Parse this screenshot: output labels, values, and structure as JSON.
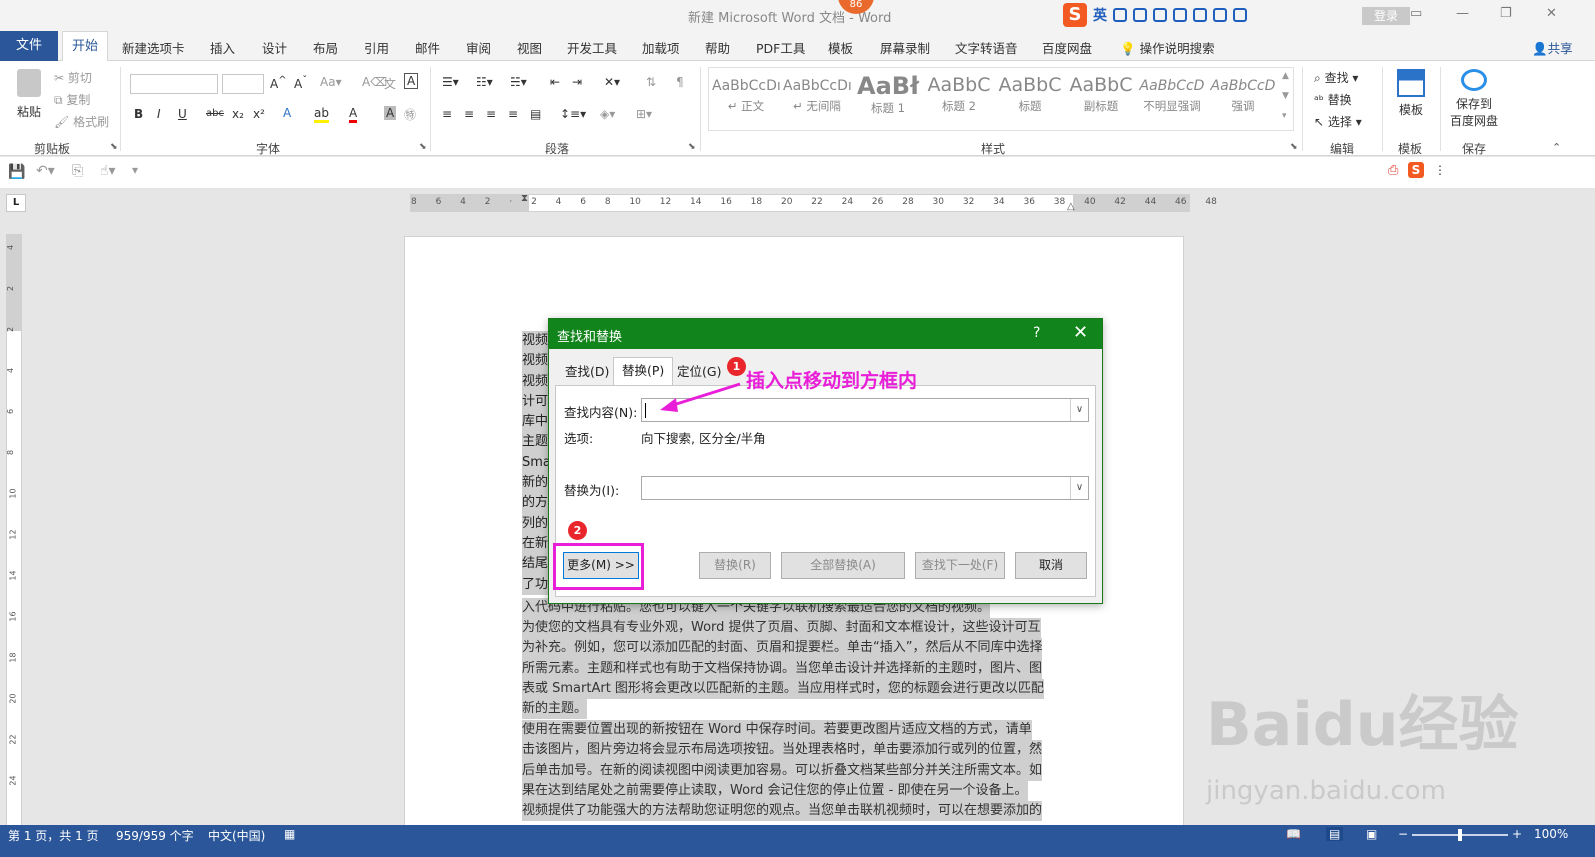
{
  "titlebar": {
    "doc_title": "新建 Microsoft Word 文档",
    "app_name": "Word",
    "notif_count": "86",
    "ime_mode": "英",
    "login": "登录"
  },
  "tabs": {
    "file": "文件",
    "active": "开始",
    "items": [
      "新建选项卡",
      "插入",
      "设计",
      "布局",
      "引用",
      "邮件",
      "审阅",
      "视图",
      "开发工具",
      "加载项",
      "帮助",
      "PDF工具",
      "模板",
      "屏幕录制",
      "文字转语音",
      "百度网盘"
    ],
    "tellme": "操作说明搜索",
    "share": "共享"
  },
  "ribbon": {
    "clipboard": {
      "label": "剪贴板",
      "paste": "粘贴",
      "cut": "剪切",
      "copy": "复制",
      "format_painter": "格式刷"
    },
    "font": {
      "label": "字体"
    },
    "paragraph": {
      "label": "段落"
    },
    "styles": {
      "label": "样式",
      "items": [
        {
          "preview": "AaBbCcDı",
          "name": "↵ 正文"
        },
        {
          "preview": "AaBbCcDı",
          "name": "↵ 无间隔"
        },
        {
          "preview": "AaBł",
          "name": "标题 1"
        },
        {
          "preview": "AaBbC",
          "name": "标题 2"
        },
        {
          "preview": "AaBbC",
          "name": "标题"
        },
        {
          "preview": "AaBbC",
          "name": "副标题"
        },
        {
          "preview": "AaBbCcD",
          "name": "不明显强调"
        },
        {
          "preview": "AaBbCcD",
          "name": "强调"
        }
      ]
    },
    "editing": {
      "label": "编辑",
      "find": "查找",
      "replace": "替换",
      "select": "选择"
    },
    "template": {
      "label": "模板",
      "button": "模板"
    },
    "save": {
      "label": "保存",
      "button_line1": "保存到",
      "button_line2": "百度网盘"
    }
  },
  "ruler": {
    "h_ticks": "8 6 4 2 · 2 4 6 8 10 12 14 16 18 20 22 24 26 28 30 32 34 36 38 40 42 44 46 48",
    "v_ticks": [
      "4",
      "2",
      "2",
      "4",
      "6",
      "8",
      "10",
      "12",
      "14",
      "16",
      "18",
      "20",
      "22",
      "24"
    ]
  },
  "document": {
    "left_fragments": [
      "视频",
      "视频",
      "视频",
      "计可",
      "库中",
      "主题",
      "Sma",
      "新的",
      "的方",
      "列的",
      "在新",
      "结尾",
      "了功"
    ],
    "paragraphs": [
      [
        "入代码中进行粘贴。您也可以键入一个关键字以联机搜索最适合您的文档的视频。"
      ],
      [
        "为使您的文档具有专业外观，Word 提供了页眉、页脚、封面和文本框设计，这些设计可互",
        "为补充。例如，您可以添加匹配的封面、页眉和提要栏。单击“插入”，然后从不同库中选择",
        "所需元素。主题和样式也有助于文档保持协调。当您单击设计并选择新的主题时，图片、图",
        "表或 SmartArt 图形将会更改以匹配新的主题。当应用样式时，您的标题会进行更改以匹配",
        "新的主题。"
      ],
      [
        "使用在需要位置出现的新按钮在 Word 中保存时间。若要更改图片适应文档的方式，请单",
        "击该图片，图片旁边将会显示布局选项按钮。当处理表格时，单击要添加行或列的位置，然",
        "后单击加号。在新的阅读视图中阅读更加容易。可以折叠文档某些部分并关注所需文本。如",
        "果在达到结尾处之前需要停止读取，Word 会记住您的停止位置 - 即使在另一个设备上。",
        "视频提供了功能强大的方法帮助您证明您的观点。当您单击联机视频时，可以在想要添加的"
      ]
    ]
  },
  "dialog": {
    "title": "查找和替换",
    "help": "?",
    "close": "✕",
    "tabs": [
      "查找(D)",
      "替换(P)",
      "定位(G)"
    ],
    "find_label": "查找内容(N):",
    "find_value": "",
    "options_label": "选项:",
    "options_value": "向下搜索, 区分全/半角",
    "replace_label": "替换为(I):",
    "replace_value": "",
    "buttons": {
      "more": "更多(M) >>",
      "replace": "替换(R)",
      "replace_all": "全部替换(A)",
      "find_next": "查找下一处(F)",
      "cancel": "取消"
    }
  },
  "annotation": {
    "marker1": "1",
    "marker2": "2",
    "text": "插入点移动到方框内",
    "color": "#e91ed8"
  },
  "statusbar": {
    "page": "第 1 页，共 1 页",
    "words": "959/959 个字",
    "language": "中文(中国)",
    "zoom": "100%"
  },
  "watermark": {
    "brand": "Baidu经验",
    "url": "jingyan.baidu.com"
  },
  "colors": {
    "accent": "#2b579a",
    "dialog_title": "#11841b"
  }
}
